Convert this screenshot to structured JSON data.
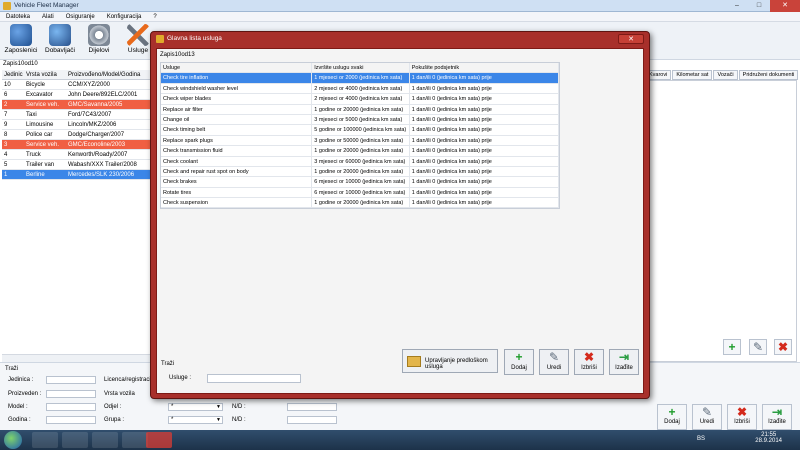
{
  "window": {
    "title": "Vehicle Fleet Manager",
    "controls": {
      "minimize": "–",
      "maximize": "□",
      "close": "✕"
    }
  },
  "menu": [
    "Datoteka",
    "Alati",
    "Osiguranje",
    "Konfiguracija",
    "?"
  ],
  "toolbar": [
    {
      "label": "Zaposlenici",
      "icon": "employees-icon"
    },
    {
      "label": "Dobavljači",
      "icon": "suppliers-icon"
    },
    {
      "label": "Dijelovi",
      "icon": "parts-gear-icon"
    },
    {
      "label": "Usluge",
      "icon": "services-tools-icon"
    }
  ],
  "vehicles": {
    "count_label": "Zapis10od10",
    "columns": [
      "Jedinic",
      "Vrsta vozila",
      "Proizvođeno/Model/Godina"
    ],
    "rows": [
      {
        "id": "10",
        "type": "Bicycle",
        "model": "CCM/XYZ/2000",
        "style": ""
      },
      {
        "id": "6",
        "type": "Excavator",
        "model": "John Deere/892ELC/2001",
        "style": ""
      },
      {
        "id": "2",
        "type": "Service veh.",
        "model": "GMC/Savanna/2005",
        "style": "red"
      },
      {
        "id": "7",
        "type": "Taxi",
        "model": "Ford/7C43/2007",
        "style": ""
      },
      {
        "id": "9",
        "type": "Limousine",
        "model": "Lincoln/MKZ/2006",
        "style": ""
      },
      {
        "id": "8",
        "type": "Police car",
        "model": "Dodge/Charger/2007",
        "style": ""
      },
      {
        "id": "3",
        "type": "Service veh.",
        "model": "GMC/Econoline/2003",
        "style": "red"
      },
      {
        "id": "4",
        "type": "Truck",
        "model": "Kenworth/Roady/2007",
        "style": ""
      },
      {
        "id": "5",
        "type": "Trailer van",
        "model": "Wabash/XXX Trailer/2008",
        "style": ""
      },
      {
        "id": "1",
        "type": "Berline",
        "model": "Mercedes/SLK 230/2006",
        "style": "blue"
      }
    ]
  },
  "search_main": {
    "heading": "Traži",
    "unit_label": "Jedinica :",
    "manufacturer_label": "Proizveden :",
    "model_label": "Model :",
    "year_label": "Godina :",
    "license_label": "Licenca/registracija :",
    "vehicle_type_label": "Vrsta vozila",
    "department_label": "Odjel :",
    "group_label": "Grupa :",
    "nd_label": "N/D :",
    "combo_value": "*"
  },
  "right_panel": {
    "tabs": [
      "Kvarovi",
      "Kilometar sat",
      "Vozači",
      "Pridruženi dokumenti"
    ]
  },
  "main_buttons": [
    {
      "label": "Dodaj",
      "glyph": "+",
      "icon": "add-icon"
    },
    {
      "label": "Uredi",
      "glyph": "✎",
      "icon": "edit-icon"
    },
    {
      "label": "Izbriši",
      "glyph": "✖",
      "icon": "delete-icon"
    },
    {
      "label": "Izađite",
      "glyph": "⇥",
      "icon": "exit-icon"
    }
  ],
  "dialog": {
    "title": "Glavna lista usluga",
    "close": "✕",
    "count_label": "Zapis10od13",
    "columns": [
      "Usluge",
      "Izvršite uslugu svaki",
      "Pokušite podsjetnik"
    ],
    "rows": [
      {
        "service": "Check tire inflation",
        "interval": "1 mjeseci or 2000 (jedinica km sata)",
        "reminder": "1 dan/ili 0 (jedinica km sata) prije",
        "selected": true
      },
      {
        "service": "Check windshield washer level",
        "interval": "2 mjeseci or 4000 (jedinica km sata)",
        "reminder": "1 dan/ili 0 (jedinica km sata) prije",
        "selected": false
      },
      {
        "service": "Check wiper blades",
        "interval": "2 mjeseci or 4000 (jedinica km sata)",
        "reminder": "1 dan/ili 0 (jedinica km sata) prije",
        "selected": false
      },
      {
        "service": "Replace air filter",
        "interval": "1 godine or 20000 (jedinica km sata)",
        "reminder": "1 dan/ili 0 (jedinica km sata) prije",
        "selected": false
      },
      {
        "service": "Change oil",
        "interval": "3 mjeseci or 5000 (jedinica km sata)",
        "reminder": "1 dan/ili 0 (jedinica km sata) prije",
        "selected": false
      },
      {
        "service": "Check timing belt",
        "interval": "5 godine or 100000 (jedinica km sata)",
        "reminder": "1 dan/ili 0 (jedinica km sata) prije",
        "selected": false
      },
      {
        "service": "Replace spark plugs",
        "interval": "3 godine or 50000 (jedinica km sata)",
        "reminder": "1 dan/ili 0 (jedinica km sata) prije",
        "selected": false
      },
      {
        "service": "Check transmission fluid",
        "interval": "1 godine or 20000 (jedinica km sata)",
        "reminder": "1 dan/ili 0 (jedinica km sata) prije",
        "selected": false
      },
      {
        "service": "Check coolant",
        "interval": "3 mjeseci or 60000 (jedinica km sata)",
        "reminder": "1 dan/ili 0 (jedinica km sata) prije",
        "selected": false
      },
      {
        "service": "Check and repair rust spot on body",
        "interval": "1 godine or 20000 (jedinica km sata)",
        "reminder": "1 dan/ili 0 (jedinica km sata) prije",
        "selected": false
      },
      {
        "service": "Check brakes",
        "interval": "6 mjeseci or 10000 (jedinica km sata)",
        "reminder": "1 dan/ili 0 (jedinica km sata) prije",
        "selected": false
      },
      {
        "service": "Rotate tires",
        "interval": "6 mjeseci or 10000 (jedinica km sata)",
        "reminder": "1 dan/ili 0 (jedinica km sata) prije",
        "selected": false
      },
      {
        "service": "Check suspension",
        "interval": "1 godine or 20000 (jedinica km sata)",
        "reminder": "1 dan/ili 0 (jedinica km sata) prije",
        "selected": false
      }
    ],
    "search": {
      "heading": "Traži",
      "label": "Usluge :",
      "value": ""
    },
    "templates_button": "Upravljanje predloškom usluga",
    "buttons": [
      {
        "label": "Dodaj",
        "glyph": "+",
        "icon": "add-icon"
      },
      {
        "label": "Uredi",
        "glyph": "✎",
        "icon": "edit-icon"
      },
      {
        "label": "Izbriši",
        "glyph": "✖",
        "icon": "delete-icon"
      },
      {
        "label": "Izađite",
        "glyph": "⇥",
        "icon": "exit-icon"
      }
    ]
  },
  "taskbar": {
    "language": "BS",
    "time": "21:55",
    "date": "28.9.2014"
  },
  "colors": {
    "dialog_frame": "#a8302b",
    "selected_row": "#3b86e8",
    "highlight_row": "#f05f43"
  }
}
